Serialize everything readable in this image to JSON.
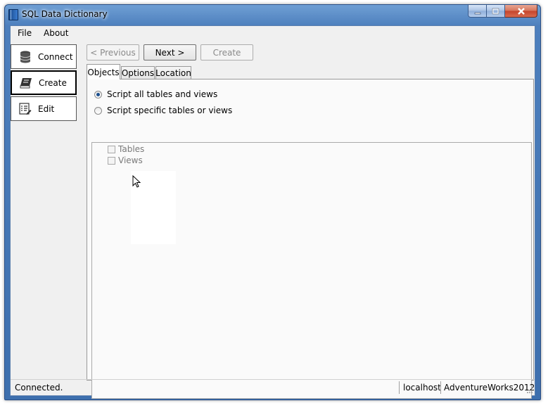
{
  "window": {
    "title": "SQL Data Dictionary"
  },
  "menu": {
    "file": "File",
    "about": "About"
  },
  "sidebar": {
    "connect": "Connect",
    "create": "Create",
    "edit": "Edit"
  },
  "nav": {
    "previous": "< Previous",
    "next": "Next >",
    "create": "Create"
  },
  "tabs": {
    "objects": "Objects",
    "options": "Options",
    "location": "Location"
  },
  "objects": {
    "radio_all": "Script all tables and views",
    "radio_specific": "Script specific tables or views",
    "selected_radio": "radio_all",
    "tree": {
      "tables": "Tables",
      "views": "Views"
    }
  },
  "status": {
    "message": "Connected.",
    "server": "localhost",
    "database": "AdventureWorks2012"
  },
  "icons": {
    "connect": "database-icon",
    "create": "book-icon",
    "edit": "list-edit-icon",
    "app": "book-app-icon"
  },
  "colors": {
    "titlebar": "#4d7fbd",
    "close_button": "#c4422a",
    "panel": "#f0f0f0"
  }
}
